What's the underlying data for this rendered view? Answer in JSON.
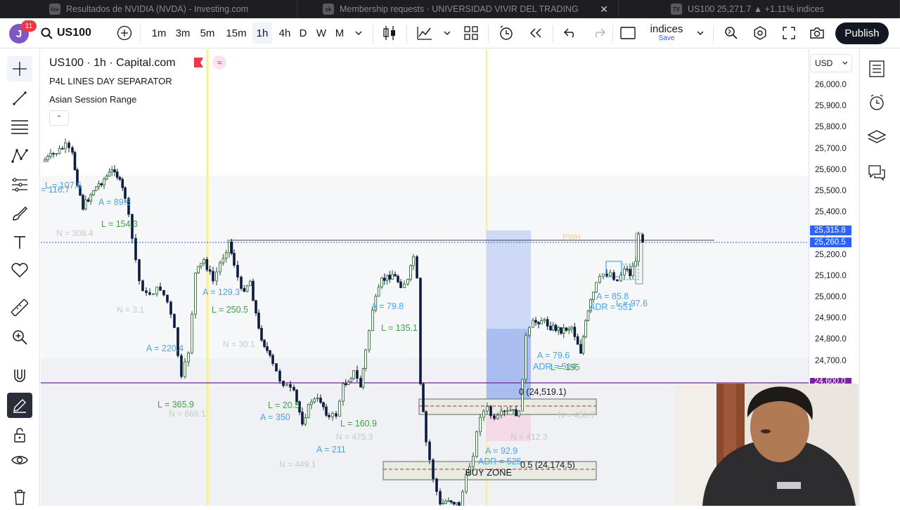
{
  "browser_tabs": [
    {
      "favicon": "Inv",
      "title": "Resultados de NVIDIA (NVDA) - Investing.com"
    },
    {
      "favicon": "sk",
      "title": "Membership requests · UNIVERSIDAD VIVIR DEL TRADING",
      "close": "✕"
    },
    {
      "favicon": "TV",
      "title": "US100 25,271.7 ▲ +1.11% indices"
    }
  ],
  "toolbar": {
    "avatar_letter": "J",
    "notification_count": "11",
    "symbol": "US100",
    "intervals": [
      "1m",
      "3m",
      "5m",
      "15m",
      "1h",
      "4h",
      "D",
      "W",
      "M"
    ],
    "active_interval": "1h",
    "layout_name": "indices",
    "layout_save": "Save",
    "publish_label": "Publish"
  },
  "legend": {
    "symbol_line": "US100 · 1h · Capital.com",
    "indicators": [
      "P4L LINES DAY SEPARATOR",
      "Asian Session Range"
    ],
    "wave_icon": "≈",
    "collapse_icon": "⌃"
  },
  "price_axis": {
    "currency": "USD",
    "ticks": [
      "26,000.0",
      "25,900.0",
      "25,800.0",
      "25,700.0",
      "25,600.0",
      "25,500.0",
      "25,400.0",
      "25,300.0",
      "25,200.0",
      "25,100.0",
      "25,000.0",
      "24,900.0",
      "24,800.0",
      "24,700.0"
    ],
    "labels": [
      {
        "text": "25,315.8",
        "color": "#2962ff"
      },
      {
        "text": "25,260.5",
        "color": "#2962ff"
      },
      {
        "text": "24,600.0",
        "color": "#7b1fa2"
      }
    ]
  },
  "annotations": {
    "blue": [
      "= 116.7",
      "L = 107.6",
      "A = 89.6",
      "A = 129.3",
      "A = 220.4",
      "A = 350",
      "A = 211",
      "A = 79.8",
      "A = 79.6",
      "ADR = 514",
      "A = 92.9",
      "ADR = 525",
      "A = 85.8",
      "ADR = 551",
      "L = 97.6"
    ],
    "green": [
      "L = 154.3",
      "L = 250.5",
      "L = 365.9",
      "L = 20.5",
      "L = 160.9",
      "L = 135.1",
      "L = 155"
    ],
    "gray": [
      "N = 308.4",
      "N = 3.1",
      "N = 30.1",
      "N = 668.1",
      "N = 475.3",
      "N = 449.1",
      "N = 450.7",
      "N = 412.3"
    ],
    "zones": [
      "0 (24,519.1)",
      "0.5 (24,174.5)",
      "BUY ZONE",
      "PWH"
    ]
  },
  "colors": {
    "up_candle": "#1b5e20",
    "down_candle": "#0d1b3e",
    "session_separator": "#fff59d",
    "buy_zone_fill": "#e8ebe0",
    "horizontal_purple": "#7b1fa2",
    "dotted_blue": "#2962ff"
  },
  "icons": {
    "left_tools": [
      "crosshair-icon",
      "trendline-icon",
      "fib-icon",
      "pattern-icon",
      "prediction-icon",
      "brush-icon",
      "text-icon",
      "heart-icon",
      "ruler-icon",
      "zoom-in-icon",
      "magnet-icon",
      "lock-drawing-icon",
      "unlock-icon",
      "eye-icon",
      "trash-icon"
    ],
    "right_tools": [
      "watchlist-icon",
      "alerts-icon",
      "layers-icon",
      "chat-icon"
    ]
  }
}
